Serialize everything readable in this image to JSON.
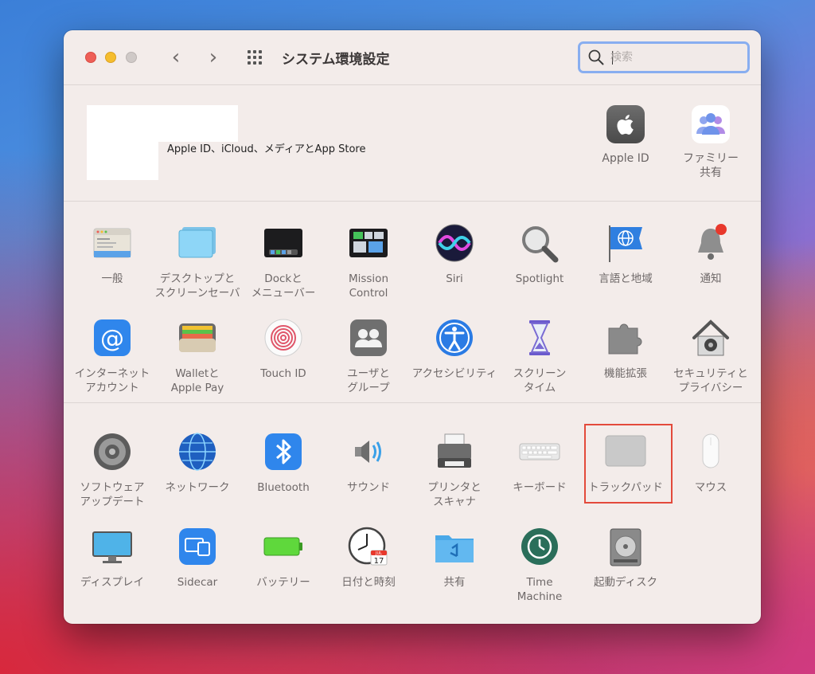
{
  "window": {
    "title": "システム環境設定",
    "search_placeholder": "検索"
  },
  "account": {
    "text": "Apple ID、iCloud、メディアとApp Store",
    "items": [
      {
        "label": "Apple ID",
        "icon": "apple-logo-icon"
      },
      {
        "label": "ファミリー\n共有",
        "icon": "family-sharing-icon"
      }
    ]
  },
  "panes": {
    "row1": [
      {
        "label": "一般",
        "icon": "general-icon"
      },
      {
        "label": "デスクトップと\nスクリーンセーバ",
        "icon": "desktop-screensaver-icon"
      },
      {
        "label": "Dockと\nメニューバー",
        "icon": "dock-menubar-icon"
      },
      {
        "label": "Mission\nControl",
        "icon": "mission-control-icon"
      },
      {
        "label": "Siri",
        "icon": "siri-icon"
      },
      {
        "label": "Spotlight",
        "icon": "spotlight-icon"
      },
      {
        "label": "言語と地域",
        "icon": "language-region-icon"
      },
      {
        "label": "通知",
        "icon": "notifications-icon"
      }
    ],
    "row2": [
      {
        "label": "インターネット\nアカウント",
        "icon": "internet-accounts-icon"
      },
      {
        "label": "Walletと\nApple Pay",
        "icon": "wallet-icon"
      },
      {
        "label": "Touch ID",
        "icon": "touch-id-icon"
      },
      {
        "label": "ユーザと\nグループ",
        "icon": "users-groups-icon"
      },
      {
        "label": "アクセシビリティ",
        "icon": "accessibility-icon"
      },
      {
        "label": "スクリーン\nタイム",
        "icon": "screen-time-icon"
      },
      {
        "label": "機能拡張",
        "icon": "extensions-icon"
      },
      {
        "label": "セキュリティと\nプライバシー",
        "icon": "security-privacy-icon"
      }
    ],
    "row3": [
      {
        "label": "ソフトウェア\nアップデート",
        "icon": "software-update-icon"
      },
      {
        "label": "ネットワーク",
        "icon": "network-icon"
      },
      {
        "label": "Bluetooth",
        "icon": "bluetooth-icon"
      },
      {
        "label": "サウンド",
        "icon": "sound-icon"
      },
      {
        "label": "プリンタと\nスキャナ",
        "icon": "printer-icon"
      },
      {
        "label": "キーボード",
        "icon": "keyboard-icon"
      },
      {
        "label": "トラックパッド",
        "icon": "trackpad-icon"
      },
      {
        "label": "マウス",
        "icon": "mouse-icon"
      }
    ],
    "row4": [
      {
        "label": "ディスプレイ",
        "icon": "display-icon"
      },
      {
        "label": "Sidecar",
        "icon": "sidecar-icon"
      },
      {
        "label": "バッテリー",
        "icon": "battery-icon"
      },
      {
        "label": "日付と時刻",
        "icon": "date-time-icon"
      },
      {
        "label": "共有",
        "icon": "sharing-icon"
      },
      {
        "label": "Time\nMachine",
        "icon": "time-machine-icon"
      },
      {
        "label": "起動ディスク",
        "icon": "startup-disk-icon"
      }
    ],
    "clock_date": {
      "month": "JUL",
      "day": "17"
    }
  },
  "highlighted_pane": "トラックパッド",
  "colors": {
    "highlight": "#e34a3b",
    "search_focus": "#88aef0",
    "window_bg": "#f3ecea"
  }
}
